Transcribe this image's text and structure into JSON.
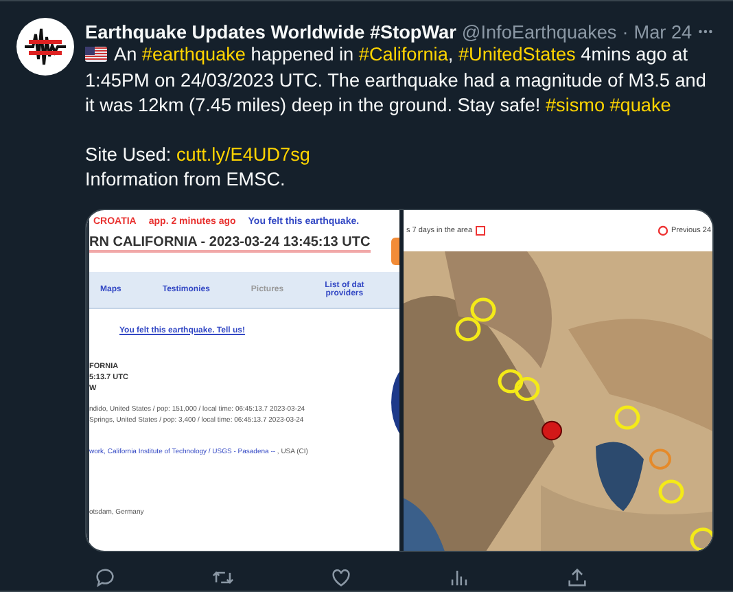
{
  "author": {
    "name": "Earthquake Updates Worldwide #StopWar",
    "handle": "@InfoEarthquakes",
    "separator": "·",
    "date": "Mar 24"
  },
  "body": [
    {
      "segments": [
        {
          "kind": "text",
          "text": "An "
        },
        {
          "kind": "hashtag",
          "text": "#earthquake"
        },
        {
          "kind": "text",
          "text": " happened in "
        },
        {
          "kind": "hashtag",
          "text": "#California"
        },
        {
          "kind": "text",
          "text": ", "
        },
        {
          "kind": "hashtag",
          "text": "#UnitedStates"
        },
        {
          "kind": "text",
          "text": " 4mins ago at 1:45PM on 24/03/2023 UTC. The earthquake had a magnitude of M3.5 and it was 12km (7.45 miles) deep in the ground. Stay safe! "
        },
        {
          "kind": "hashtag",
          "text": "#sismo"
        },
        {
          "kind": "hashtag",
          "text": "#quake"
        }
      ]
    },
    {
      "segments": [
        {
          "kind": "text",
          "text": "Site Used: "
        },
        {
          "kind": "link",
          "text": "cutt.ly/E4UD7sg"
        }
      ]
    },
    {
      "segments": [
        {
          "kind": "text",
          "text": "Information from EMSC."
        }
      ]
    }
  ],
  "media": {
    "left": {
      "top_line": [
        {
          "kind": "alert",
          "text": "CROATIA"
        },
        {
          "kind": "alert",
          "text": "app. 2 minutes ago"
        },
        {
          "kind": "notice",
          "text": "You felt this earthquake."
        }
      ],
      "headline": "RN CALIFORNIA - 2023-03-24 13:45:13 UTC",
      "tabs": [
        {
          "label": "Maps",
          "disabled": false
        },
        {
          "label": "Testimonies",
          "disabled": false
        },
        {
          "label": "Pictures",
          "disabled": true
        },
        {
          "label": "List of dat\nproviders",
          "disabled": false
        }
      ],
      "tell_link": "You felt this earthquake. Tell us!",
      "details": [
        "FORNIA",
        "5:13.7 UTC",
        "W"
      ],
      "places": [
        "ndido, United States / pop: 151,000 / local time: 06:45:13.7 2023-03-24",
        "Springs, United States / pop: 3,400 / local time: 06:45:13.7 2023-03-24"
      ],
      "network_link": "work, California Institute of Technology / USGS - Pasadena --",
      "network_rest": ", USA (CI)",
      "footer": "otsdam, Germany"
    },
    "right": {
      "legend_left": "s 7 days in the area",
      "legend_right": "Previous 24"
    }
  }
}
